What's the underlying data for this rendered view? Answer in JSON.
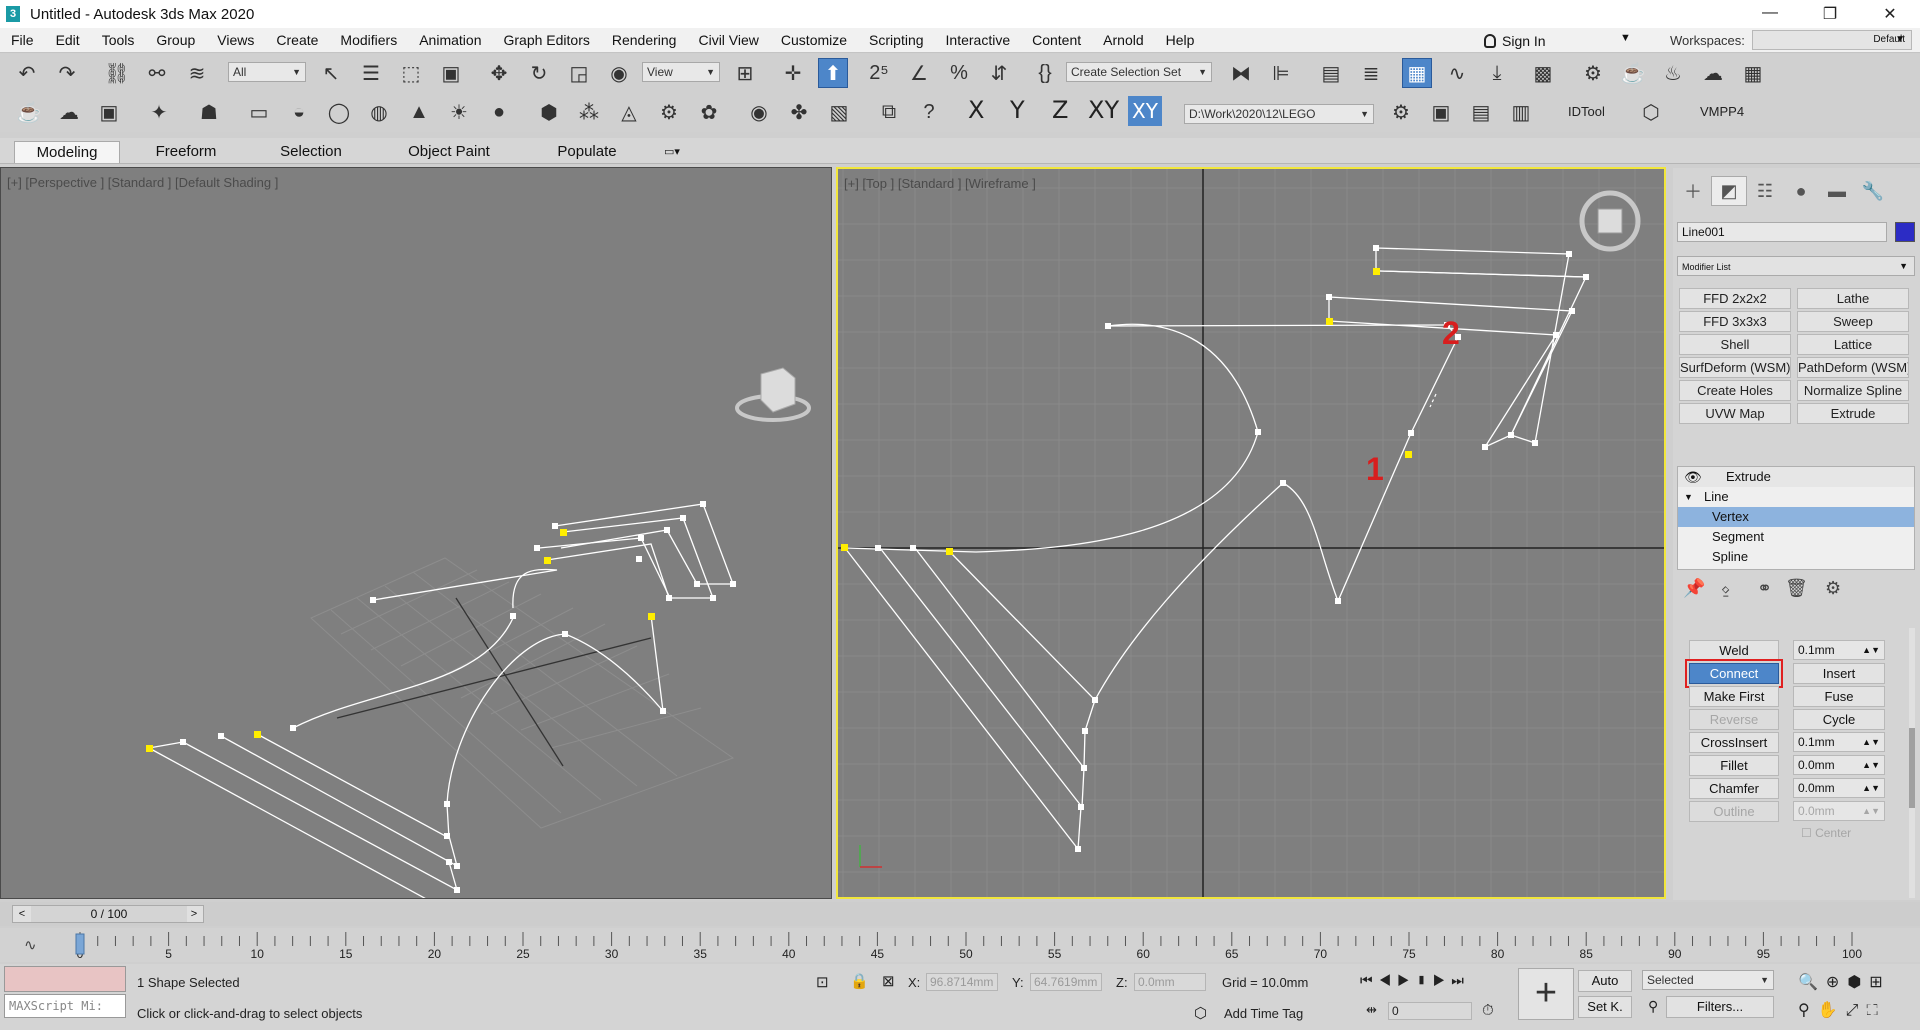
{
  "app": {
    "title": "Untitled - Autodesk 3ds Max 2020",
    "logo": "3"
  },
  "window_controls": [
    "—",
    "❐",
    "✕"
  ],
  "menu": [
    "File",
    "Edit",
    "Tools",
    "Group",
    "Views",
    "Create",
    "Modifiers",
    "Animation",
    "Graph Editors",
    "Rendering",
    "Civil View",
    "Customize",
    "Scripting",
    "Interactive",
    "Content",
    "Arnold",
    "Help"
  ],
  "signin": {
    "label": "Sign In",
    "arrow": "▼"
  },
  "workspaces": {
    "label": "Workspaces:",
    "value": "Default",
    "arrow": "▼"
  },
  "toolbar": {
    "filter": "All",
    "refcoord": "View",
    "selset": "Create Selection Set",
    "arrow": "▼",
    "path": "D:\\Work\\2020\\12\\LEGO",
    "idtool": "IDTool",
    "vmpp": "VMPP4",
    "axes": [
      "X",
      "Y",
      "Z",
      "XY",
      "XY"
    ]
  },
  "ribbon_tabs": [
    "Modeling",
    "Freeform",
    "Selection",
    "Object Paint",
    "Populate"
  ],
  "viewports": {
    "left": {
      "label": "[+] [Perspective ] [Standard ] [Default Shading ]"
    },
    "right": {
      "label": "[+] [Top ] [Standard ] [Wireframe ]",
      "annotation1": "1",
      "annotation2": "2"
    }
  },
  "command_panel": {
    "object_name": "Line001",
    "object_color": "#2c2cc5",
    "modifier_list": "Modifier List",
    "modifier_buttons": [
      "FFD 2x2x2",
      "Lathe",
      "FFD 3x3x3",
      "Sweep",
      "Shell",
      "Lattice",
      "SurfDeform (WSM)",
      "PathDeform (WSM)",
      "Create Holes",
      "Normalize Spline",
      "UVW Map",
      "Extrude"
    ],
    "stack": {
      "extrude": "Extrude",
      "line": "Line",
      "vertex": "Vertex",
      "segment": "Segment",
      "spline": "Spline"
    },
    "geometry": {
      "weld": "Weld",
      "weld_val": "0.1mm",
      "connect": "Connect",
      "insert": "Insert",
      "make_first": "Make First",
      "fuse": "Fuse",
      "reverse": "Reverse",
      "cycle": "Cycle",
      "crossinsert": "CrossInsert",
      "crossinsert_val": "0.1mm",
      "fillet": "Fillet",
      "fillet_val": "0.0mm",
      "chamfer": "Chamfer",
      "chamfer_val": "0.0mm",
      "outline": "Outline",
      "outline_val": "0.0mm",
      "center": "Center"
    }
  },
  "time": {
    "slider": "0 / 100",
    "ticks": [
      "0",
      "5",
      "10",
      "15",
      "20",
      "25",
      "30",
      "35",
      "40",
      "45",
      "50",
      "55",
      "60",
      "65",
      "70",
      "75",
      "80",
      "85",
      "90",
      "95",
      "100"
    ]
  },
  "status": {
    "maxscript": "MAXScript Mi:",
    "selected": "1 Shape Selected",
    "prompt": "Click or click-and-drag to select objects",
    "x_label": "X:",
    "x": "96.8714mm",
    "y_label": "Y:",
    "y": "64.7619mm",
    "z_label": "Z:",
    "z": "0.0mm",
    "grid": "Grid = 10.0mm",
    "add_time_tag": "Add Time Tag",
    "auto": "Auto",
    "setk": "Set K.",
    "sel_dd": "Selected",
    "filters": "Filters...",
    "frame": "0"
  }
}
